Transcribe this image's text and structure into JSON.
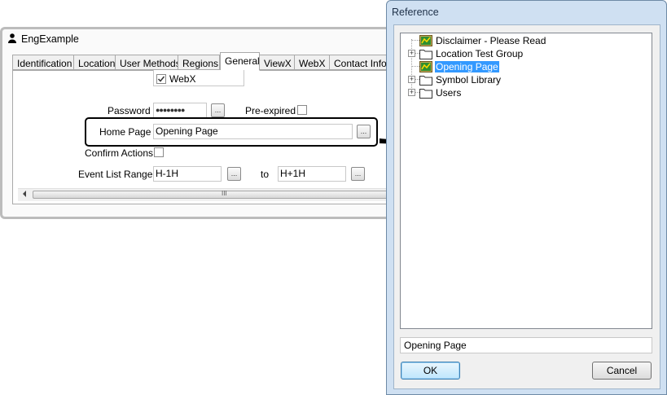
{
  "eng_window": {
    "title": "EngExample",
    "tabs": [
      {
        "label": "Identification"
      },
      {
        "label": "Location"
      },
      {
        "label": "User Methods"
      },
      {
        "label": "Regions"
      },
      {
        "label": "General"
      },
      {
        "label": "ViewX"
      },
      {
        "label": "WebX"
      },
      {
        "label": "Contact Infor"
      }
    ],
    "active_tab": "General",
    "webx_checkbox": {
      "label": "WebX",
      "checked": true
    },
    "password": {
      "label": "Password",
      "value": "●●●●●●●●",
      "browse": "..."
    },
    "pre_expired": {
      "label": "Pre-expired",
      "checked": false
    },
    "home_page": {
      "label": "Home Page",
      "value": "Opening Page",
      "browse": "..."
    },
    "confirm_actions": {
      "label": "Confirm Actions",
      "checked": false
    },
    "event_list_range": {
      "label": "Event List Range",
      "from": "H-1H",
      "to_label": "to",
      "to": "H+1H",
      "browse": "..."
    },
    "scroll_grip": "III"
  },
  "reference_dialog": {
    "title": "Reference",
    "tree": [
      {
        "label": "Disclaimer - Please Read",
        "icon": "mimic-page-icon",
        "expandable": false
      },
      {
        "label": "Location Test Group",
        "icon": "folder-icon",
        "expandable": true
      },
      {
        "label": "Opening Page",
        "icon": "mimic-page-icon",
        "expandable": false,
        "selected": true
      },
      {
        "label": "Symbol Library",
        "icon": "folder-icon",
        "expandable": true
      },
      {
        "label": "Users",
        "icon": "folder-icon",
        "expandable": true
      }
    ],
    "selection": "Opening Page",
    "ok_label": "OK",
    "cancel_label": "Cancel",
    "expander_glyph": "+"
  },
  "colors": {
    "selection": "#3399ff",
    "dialog_frame": "#cfe0f2",
    "arrow": "#000000"
  }
}
